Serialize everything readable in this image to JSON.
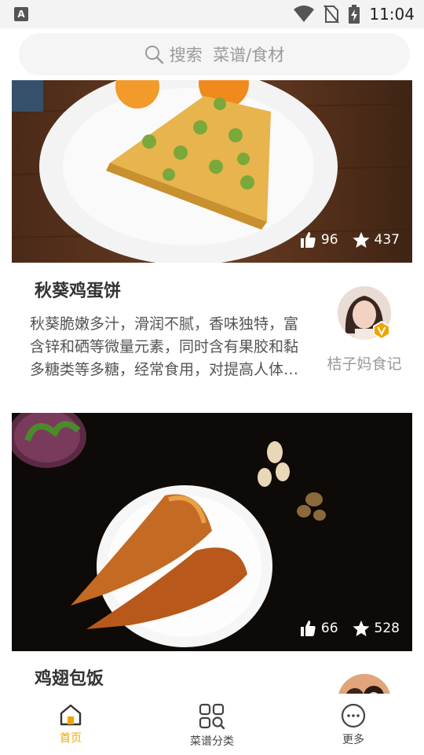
{
  "status_bar": {
    "app_badge": "A",
    "time": "11:04"
  },
  "search": {
    "icon": "search-icon",
    "placeholder": "搜索  菜谱/食材"
  },
  "recipes": [
    {
      "title": "秋葵鸡蛋饼",
      "description": "秋葵脆嫩多汁，滑润不腻，香味独特，富含锌和硒等微量元素，同时含有果胶和黏多糖类等多糖，经常食用，对提高人体免疫力…",
      "likes": "96",
      "favorites": "437",
      "author": "桔子妈食记"
    },
    {
      "title": "鸡翅包饭",
      "likes": "66",
      "favorites": "528"
    }
  ],
  "nav": [
    {
      "label": "首页",
      "icon": "home-icon"
    },
    {
      "label": "菜谱分类",
      "icon": "category-search-icon"
    },
    {
      "label": "更多",
      "icon": "more-icon"
    }
  ],
  "colors": {
    "accent": "#f0a500",
    "text": "#333333",
    "muted": "#999999"
  }
}
